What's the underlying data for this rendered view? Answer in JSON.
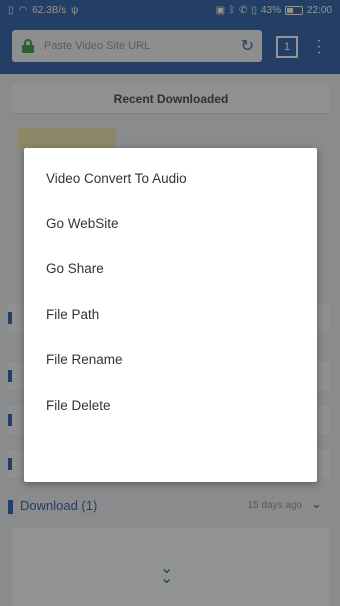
{
  "status_bar": {
    "speed": "62.3B/s",
    "battery": "43%",
    "battery_level": 0.43,
    "time": "22:00"
  },
  "browser": {
    "url_placeholder": "Paste Video Site URL",
    "tab_count": "1"
  },
  "recent": {
    "title": "Recent Downloaded"
  },
  "download_section": {
    "label": "Download (1)",
    "time_ago": "15 days ago"
  },
  "context_menu": {
    "items": [
      "Video Convert To Audio",
      "Go WebSite",
      "Go Share",
      "File Path",
      "File Rename",
      "File Delete"
    ]
  },
  "colors": {
    "accent": "#3f6db0",
    "lock": "#4aa84a"
  }
}
